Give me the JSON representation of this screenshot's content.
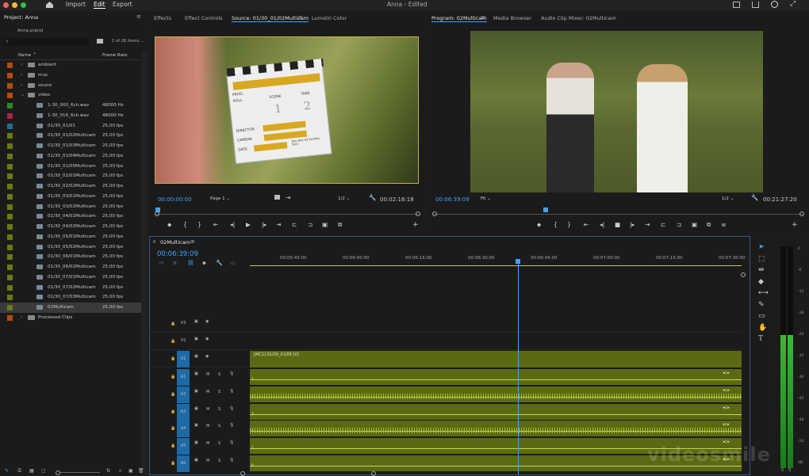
{
  "app": {
    "title": "Anna - Edited",
    "colors": {
      "accent": "#3ea3ff",
      "clip": "#5b6a12",
      "label_blue": "#1d6aa8",
      "window_close": "#ff5f57",
      "window_min": "#febc2e",
      "window_max": "#28c840"
    }
  },
  "menu": {
    "home_icon": "home-icon",
    "import": "Import",
    "edit": "Edit",
    "export": "Export"
  },
  "project": {
    "tab": "Project: Anna",
    "file": "Anna.prproj",
    "search_placeholder": "",
    "count": "1 of 26 items ...",
    "col_name": "Name",
    "col_rate": "Frame Rate",
    "items": [
      {
        "name": "ambient",
        "rate": "",
        "color": "#b54a12",
        "type": "folder",
        "indent": 1
      },
      {
        "name": "mus",
        "rate": "",
        "color": "#b54a12",
        "type": "folder",
        "indent": 1
      },
      {
        "name": "sound",
        "rate": "",
        "color": "#b54a12",
        "type": "folder",
        "indent": 1
      },
      {
        "name": "video",
        "rate": "",
        "color": "#b54a12",
        "type": "folder",
        "indent": 1
      },
      {
        "name": "1-30_000_6ch.wav",
        "rate": "48000 Hz",
        "color": "#2a8a2a",
        "type": "audio",
        "indent": 2
      },
      {
        "name": "1-30_016_6ch.wav",
        "rate": "48000 Hz",
        "color": "#b0204a",
        "type": "audio",
        "indent": 2
      },
      {
        "name": "01/30_01/01",
        "rate": "25,00 fps",
        "color": "#2a6a8a",
        "type": "seq",
        "indent": 2
      },
      {
        "name": "01/30_01/02Multicam",
        "rate": "25,00 fps",
        "color": "#6a7a12",
        "type": "clip",
        "indent": 2
      },
      {
        "name": "01/30_01/03Multicam",
        "rate": "25,00 fps",
        "color": "#6a7a12",
        "type": "clip",
        "indent": 2
      },
      {
        "name": "01/30_01/04Multicam",
        "rate": "25,00 fps",
        "color": "#6a7a12",
        "type": "clip",
        "indent": 2
      },
      {
        "name": "01/30_01/05Multicam",
        "rate": "25,00 fps",
        "color": "#6a7a12",
        "type": "clip",
        "indent": 2
      },
      {
        "name": "01/30_02/01Multicam",
        "rate": "25,00 fps",
        "color": "#6a7a12",
        "type": "clip",
        "indent": 2
      },
      {
        "name": "01/30_02/02Multicam",
        "rate": "25,00 fps",
        "color": "#6a7a12",
        "type": "clip",
        "indent": 2
      },
      {
        "name": "01/30_03/01Multicam",
        "rate": "25,00 fps",
        "color": "#6a7a12",
        "type": "clip",
        "indent": 2
      },
      {
        "name": "01/30_03/02Multicam",
        "rate": "25,00 fps",
        "color": "#6a7a12",
        "type": "clip",
        "indent": 2
      },
      {
        "name": "01/30_04/01Multicam",
        "rate": "25,00 fps",
        "color": "#6a7a12",
        "type": "clip",
        "indent": 2
      },
      {
        "name": "01/30_04/02Multicam",
        "rate": "25,00 fps",
        "color": "#6a7a12",
        "type": "clip",
        "indent": 2
      },
      {
        "name": "01/30_05/01Multicam",
        "rate": "25,00 fps",
        "color": "#6a7a12",
        "type": "clip",
        "indent": 2
      },
      {
        "name": "01/30_05/02Multicam",
        "rate": "25,00 fps",
        "color": "#6a7a12",
        "type": "clip",
        "indent": 2
      },
      {
        "name": "01/30_06/01Multicam",
        "rate": "25,00 fps",
        "color": "#6a7a12",
        "type": "clip",
        "indent": 2
      },
      {
        "name": "01/30_06/02Multicam",
        "rate": "25,00 fps",
        "color": "#6a7a12",
        "type": "clip",
        "indent": 2
      },
      {
        "name": "01/30_07/01Multicam",
        "rate": "25,00 fps",
        "color": "#6a7a12",
        "type": "clip",
        "indent": 2
      },
      {
        "name": "01/30_07/02Multicam",
        "rate": "25,00 fps",
        "color": "#6a7a12",
        "type": "clip",
        "indent": 2
      },
      {
        "name": "01/30_07/03Multicam",
        "rate": "25,00 fps",
        "color": "#6a7a12",
        "type": "clip",
        "indent": 2
      },
      {
        "name": "02Multicam",
        "rate": "25,00 fps",
        "color": "#6a7a12",
        "type": "seq",
        "indent": 2,
        "selected": true
      },
      {
        "name": "Processed Clips",
        "rate": "",
        "color": "#b54a12",
        "type": "folder",
        "indent": 1
      }
    ]
  },
  "source_panel": {
    "tabs": [
      "Effects",
      "Effect Controls",
      "Source: 01/30_01/02Multicam",
      "Lumetri Color"
    ],
    "timecode_in": "00:00:00:00",
    "page": "Page 1",
    "fraction": "1/2",
    "duration": "00:02:16:18",
    "slate": {
      "roll": "ROLL",
      "scene": "SCENE",
      "take": "TAKE",
      "prod": "PROD.",
      "director": "DIRECTOR",
      "camera": "CAMERA",
      "date": "DATE",
      "scene_num": "1",
      "take_num": "2",
      "footer": "Day Nite Int Ext Mos Sync"
    }
  },
  "program_panel": {
    "tabs": [
      "Program: 02Multicam",
      "Media Browser",
      "Audio Clip Mixer: 02Multicam"
    ],
    "timecode": "00:06:39:09",
    "fit": "Fit",
    "fraction": "1/2",
    "duration": "00:21:27:20"
  },
  "timeline": {
    "tab": "02Multicam",
    "timecode": "00:06:39:09",
    "ruler": [
      "00:05:45:00",
      "00:06:00:00",
      "00:06:15:00",
      "00:06:30:00",
      "00:06:45:00",
      "00:07:00:00",
      "00:07:15:00",
      "00:07:30:00"
    ],
    "video_tracks": [
      "V3",
      "V2",
      "V1"
    ],
    "audio_tracks": [
      "A1",
      "A2",
      "A3",
      "A4",
      "A5",
      "A6"
    ],
    "clip_label": "[MC1] 01/30_01/05 [V]",
    "audio_nums": [
      "1",
      "2",
      "3",
      "4",
      "5",
      "6"
    ],
    "track_m": "M",
    "track_s": "S",
    "playhead_position_percent": 54.5
  },
  "meters": {
    "labels": [
      "0",
      "-6",
      "-12",
      "-18",
      "-24",
      "-30",
      "-36",
      "-42",
      "-48",
      "-54",
      "dB"
    ],
    "solo": [
      "S",
      "S"
    ],
    "level_left_percent": 60,
    "level_right_percent": 60
  },
  "watermark": "videosmile"
}
